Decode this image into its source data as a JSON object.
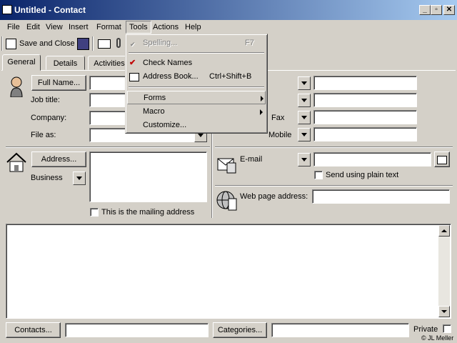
{
  "window": {
    "title": "Untitled - Contact"
  },
  "menubar": [
    "File",
    "Edit",
    "View",
    "Insert",
    "Format",
    "Tools",
    "Actions",
    "Help"
  ],
  "toolbar": {
    "save_close": "Save and Close"
  },
  "tabs": [
    "General",
    "Details",
    "Activities"
  ],
  "form": {
    "full_name_button": "Full Name...",
    "job_title": "Job title:",
    "company": "Company:",
    "file_as": "File as:",
    "address_button": "Address...",
    "address_type": "Business",
    "mailing_address": "This is the mailing address",
    "phone_partial_fax": "Fax",
    "phone_partial_mobile": "Mobile",
    "email_label": "E-mail",
    "plain_text": "Send using plain text",
    "web_page": "Web page address:",
    "contacts_button": "Contacts...",
    "categories_button": "Categories...",
    "private": "Private",
    "watermark": "© JL Meller"
  },
  "tools_menu": {
    "spelling": "Spelling...",
    "spelling_sc": "F7",
    "check_names": "Check Names",
    "address_book": "Address Book...",
    "address_book_sc": "Ctrl+Shift+B",
    "forms": "Forms",
    "macro": "Macro",
    "customize": "Customize..."
  },
  "colors": {
    "title_start": "#0a246a",
    "title_end": "#a6caf0",
    "face": "#d4d0c8"
  }
}
